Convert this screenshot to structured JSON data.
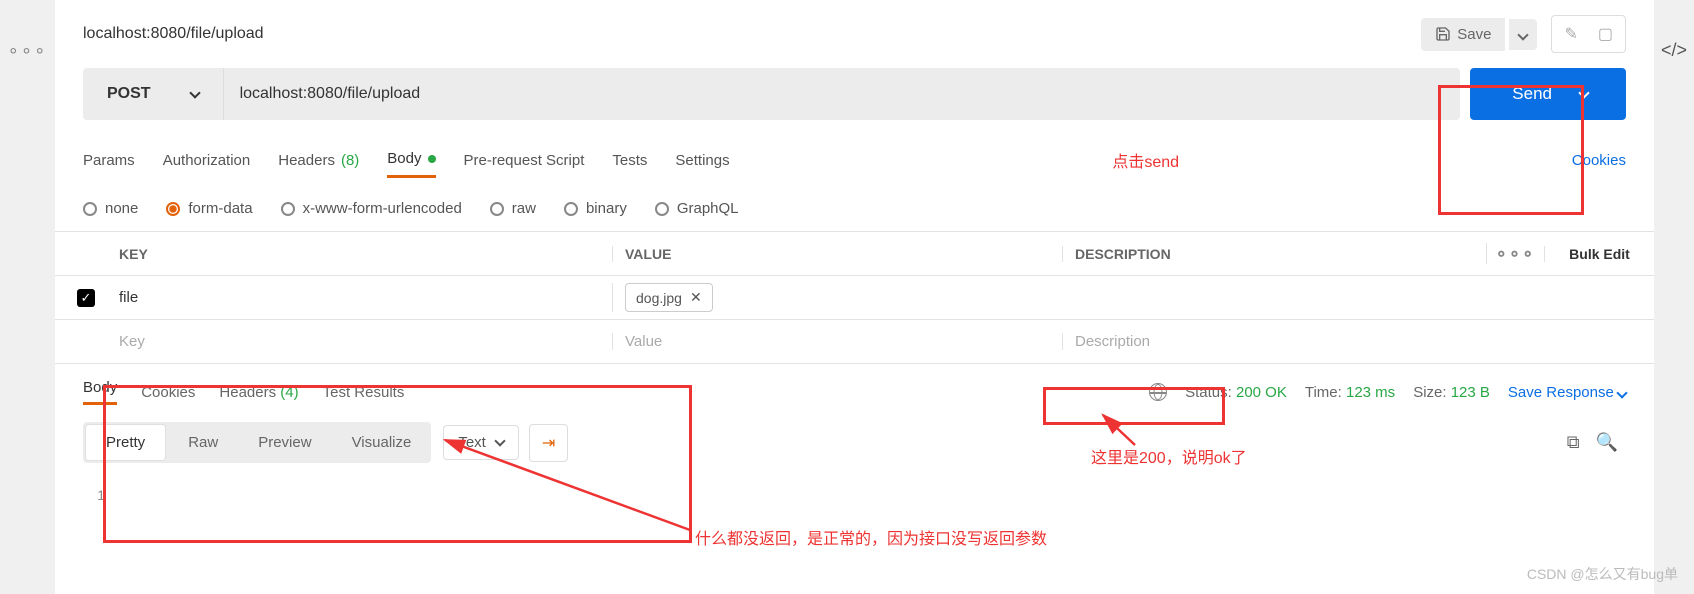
{
  "header": {
    "title": "localhost:8080/file/upload",
    "save_label": "Save"
  },
  "request": {
    "method": "POST",
    "url": "localhost:8080/file/upload",
    "send_label": "Send"
  },
  "req_tabs": {
    "params": "Params",
    "auth": "Authorization",
    "headers_label": "Headers",
    "headers_count": "(8)",
    "body": "Body",
    "prerequest": "Pre-request Script",
    "tests": "Tests",
    "settings": "Settings",
    "cookies": "Cookies"
  },
  "body_types": {
    "none": "none",
    "formdata": "form-data",
    "urlencoded": "x-www-form-urlencoded",
    "raw": "raw",
    "binary": "binary",
    "graphql": "GraphQL"
  },
  "kv": {
    "header_key": "KEY",
    "header_value": "VALUE",
    "header_desc": "DESCRIPTION",
    "bulk": "Bulk Edit",
    "rows": [
      {
        "key": "file",
        "value": "dog.jpg",
        "desc": ""
      }
    ],
    "placeholders": {
      "key": "Key",
      "value": "Value",
      "desc": "Description"
    }
  },
  "resp_tabs": {
    "body": "Body",
    "cookies": "Cookies",
    "headers_label": "Headers",
    "headers_count": "(4)",
    "test_results": "Test Results"
  },
  "status": {
    "status_label": "Status:",
    "status_value": "200 OK",
    "time_label": "Time:",
    "time_value": "123 ms",
    "size_label": "Size:",
    "size_value": "123 B",
    "save_response": "Save Response"
  },
  "view": {
    "pretty": "Pretty",
    "raw": "Raw",
    "preview": "Preview",
    "visualize": "Visualize",
    "format": "Text"
  },
  "response_body": {
    "lines": [
      {
        "n": "1",
        "content": ""
      }
    ]
  },
  "annotations": {
    "send": "点击send",
    "status": "这里是200，说明ok了",
    "empty": "什么都没返回，是正常的，因为接口没写返回参数",
    "watermark": "CSDN @怎么又有bug单"
  }
}
